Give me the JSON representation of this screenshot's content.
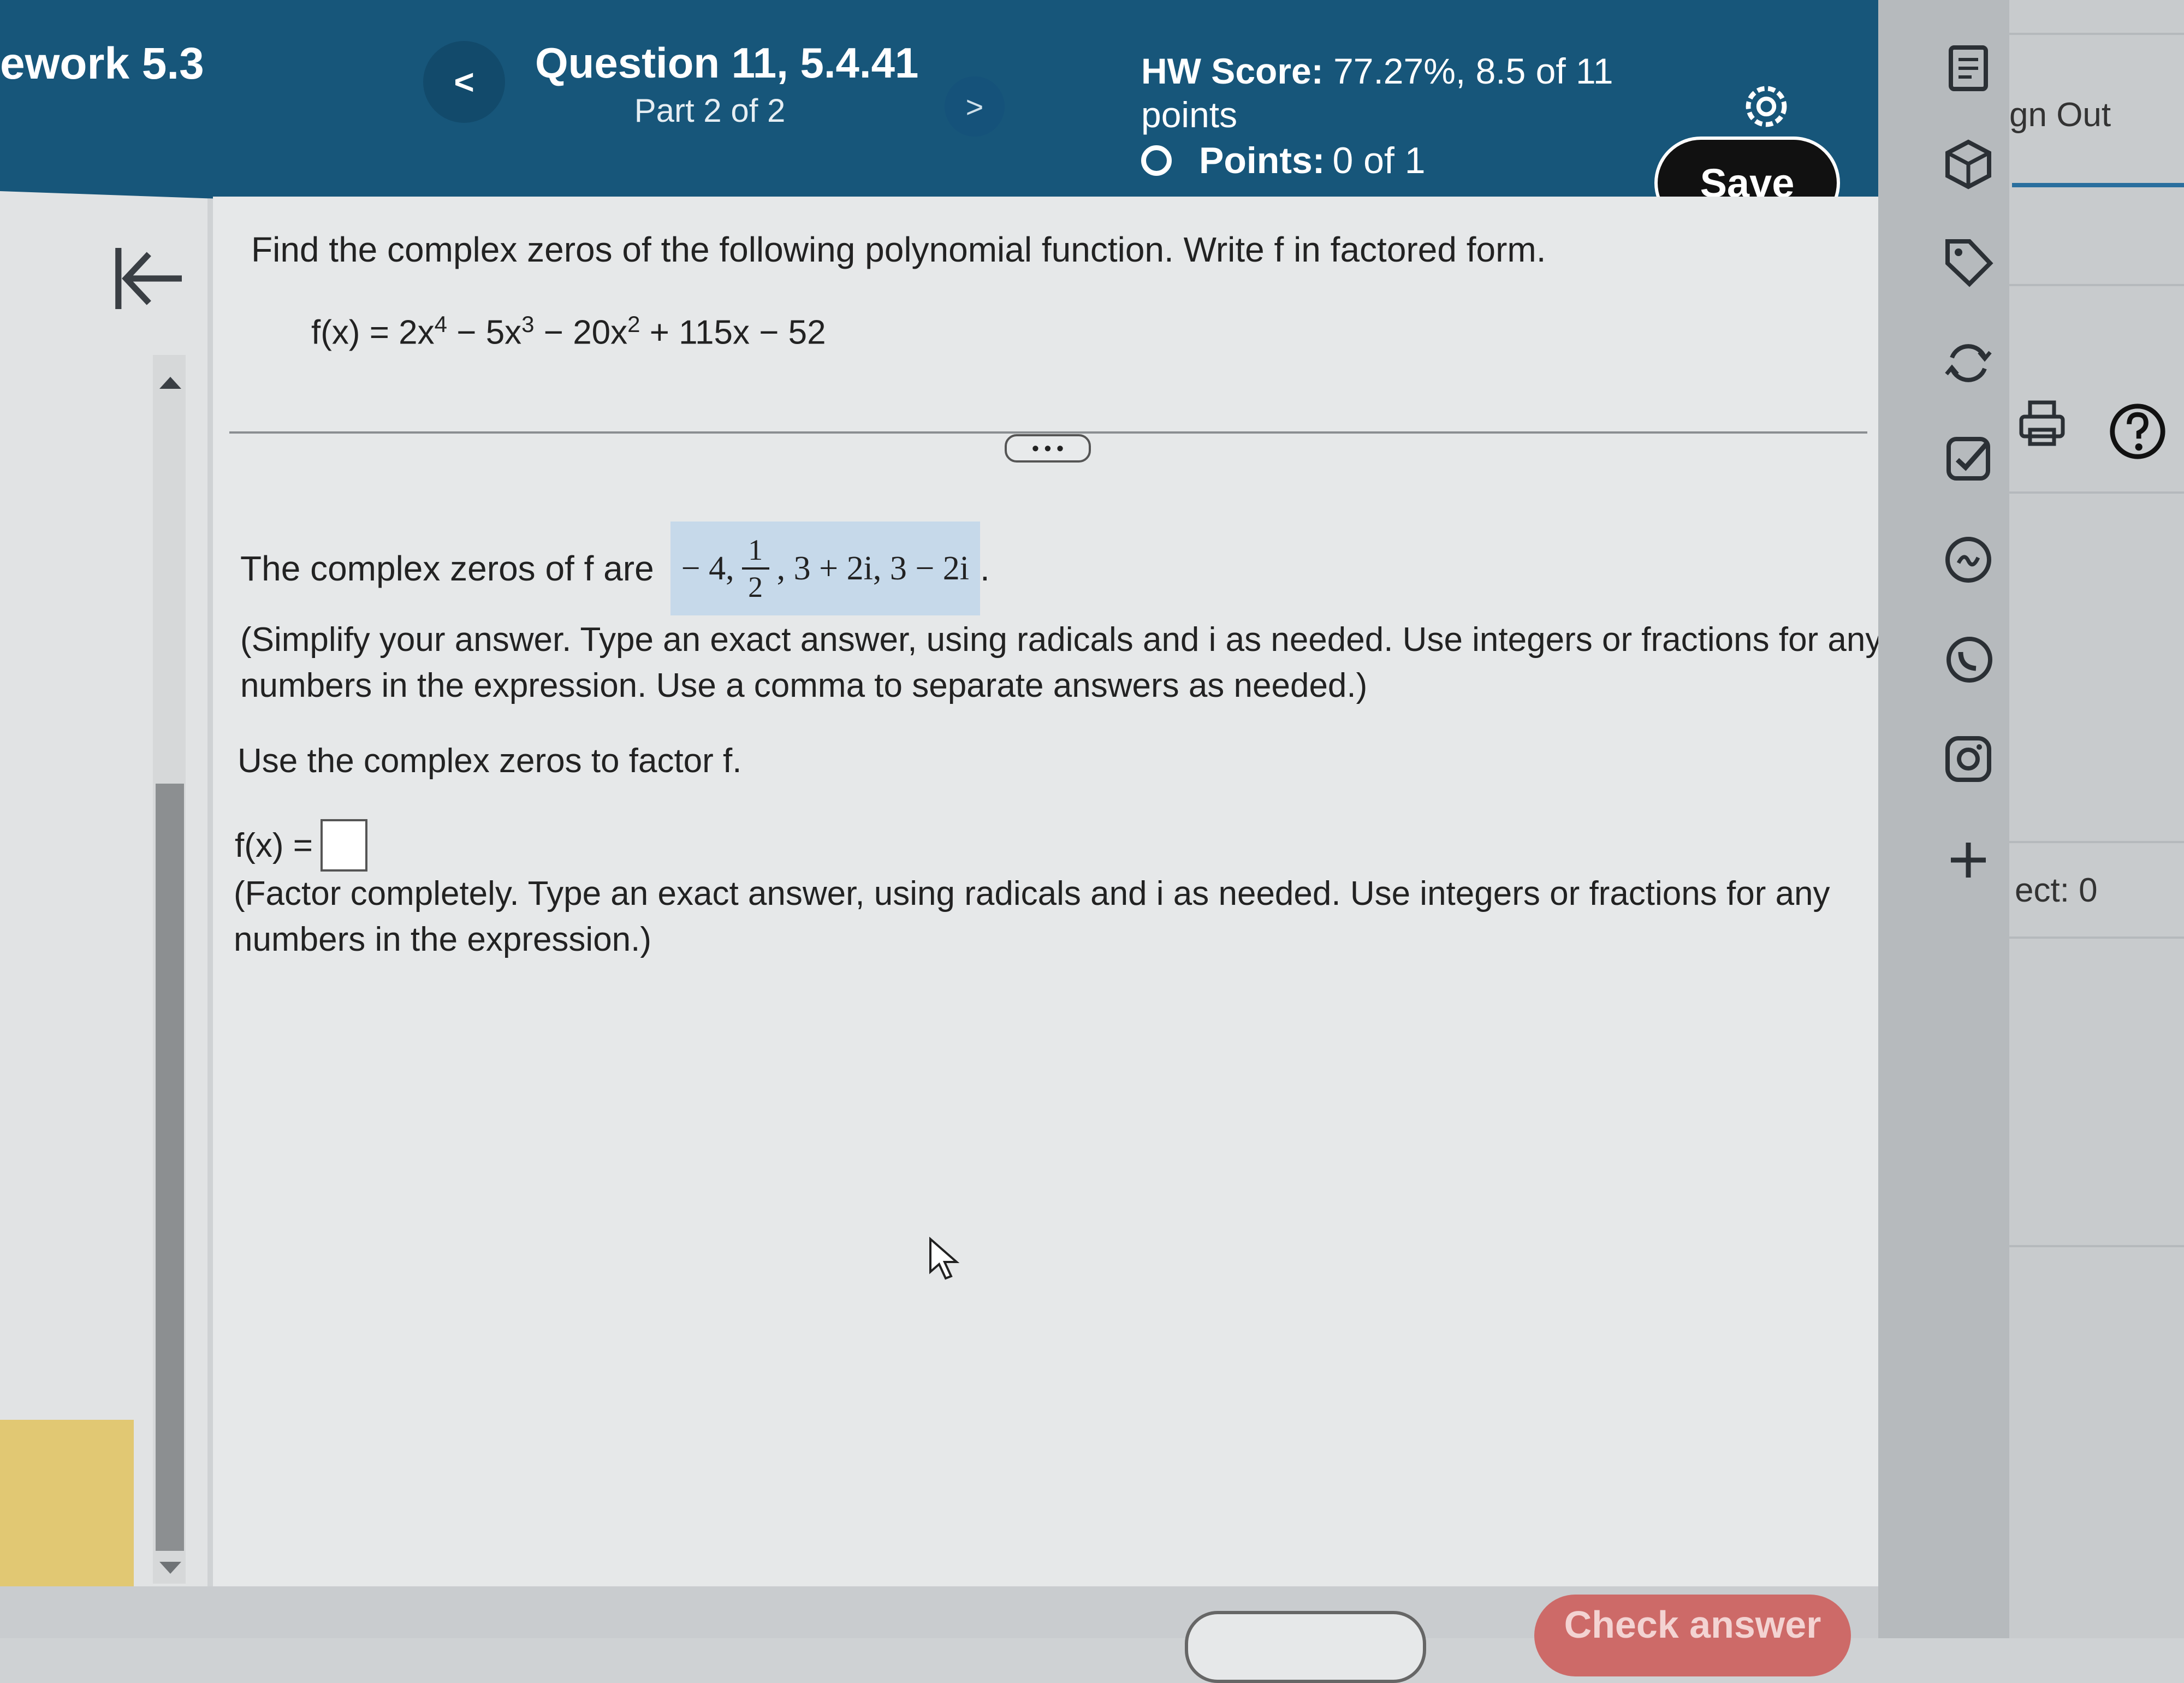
{
  "header": {
    "assignment_title": "ework 5.3",
    "prev_label": "<",
    "next_label": ">",
    "question_title": "Question 11, 5.4.41",
    "question_part": "Part 2 of 2",
    "hw_score_label": "HW Score:",
    "hw_score_value": "77.27%, 8.5 of 11 points",
    "points_label": "Points:",
    "points_value": "0 of 1",
    "save_label": "Save"
  },
  "question": {
    "instructions": "Find the complex zeros of the following polynomial function. Write f in factored form.",
    "function_lhs": "f(x) = 2x",
    "exp1": "4",
    "term2": " − 5x",
    "exp2": "3",
    "term3": " − 20x",
    "exp3": "2",
    "term4": " + 115x − 52"
  },
  "part1": {
    "prompt": "The complex zeros of f are",
    "zero1": "− 4,",
    "frac_num": "1",
    "frac_den": "2",
    "rest": ", 3 + 2i, 3 − 2i",
    "period": ".",
    "hint_line1": "(Simplify your answer. Type an exact answer, using radicals and i as needed. Use integers or fractions for any",
    "hint_line2": "numbers in the expression. Use a comma to separate answers as needed.)"
  },
  "part2": {
    "prompt": "Use the complex zeros to factor f.",
    "answer_label": "f(x) =",
    "answer_value": "",
    "hint_line1": "(Factor completely. Type an exact answer, using radicals and i as needed. Use integers or fractions for any",
    "hint_line2": "numbers in the expression.)"
  },
  "expand_label": "• • •",
  "footer": {
    "check_answer_label": "Check answer"
  },
  "right_panel": {
    "sign_out": "gn Out",
    "count_text": "ect: 0",
    "icons": [
      "document-icon",
      "cube-icon",
      "tag-icon",
      "refresh-icon",
      "checklist-icon",
      "chat-icon",
      "whatsapp-icon",
      "instagram-icon",
      "plus-icon",
      "print-icon",
      "help-icon"
    ]
  },
  "colors": {
    "header_bg": "#17567a",
    "answer_highlight": "#c6d9ea",
    "save_button": "#111111",
    "check_answer_button": "#cd6a68"
  }
}
